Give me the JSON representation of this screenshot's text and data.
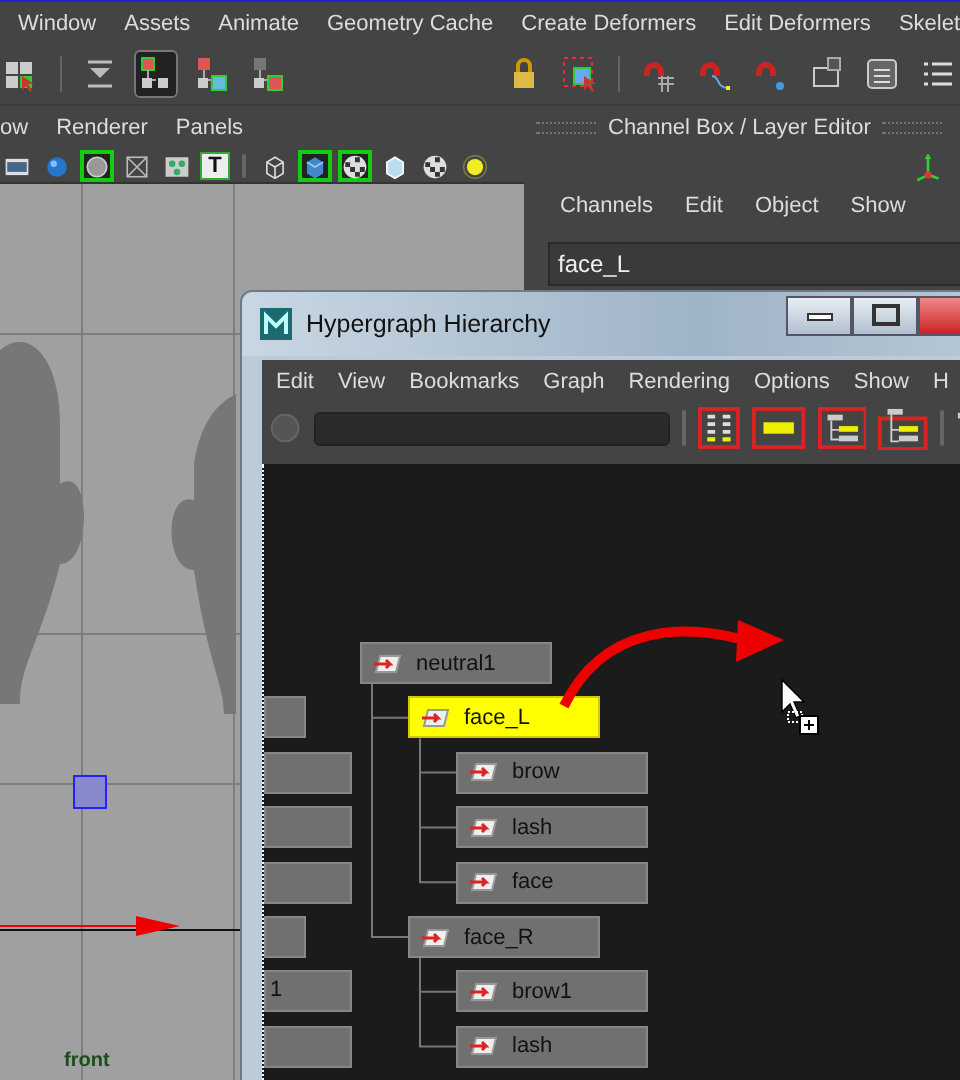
{
  "menubar": {
    "items": [
      "Window",
      "Assets",
      "Animate",
      "Geometry Cache",
      "Create Deformers",
      "Edit Deformers",
      "Skelet"
    ]
  },
  "toolbar": {
    "left_groups": [
      [
        {
          "kind": "grid",
          "selected": false
        }
      ],
      [
        {
          "kind": "align",
          "selected": false
        },
        {
          "kind": "hierarchy-red",
          "selected": true
        },
        {
          "kind": "hierarchy-blue",
          "selected": false
        },
        {
          "kind": "hierarchy-green",
          "selected": false
        }
      ]
    ],
    "right_groups": [
      [
        {
          "kind": "lock",
          "selected": false
        },
        {
          "kind": "select-box",
          "selected": false
        }
      ],
      [
        {
          "kind": "magnet-grid",
          "selected": false
        },
        {
          "kind": "magnet-curve",
          "selected": false
        },
        {
          "kind": "magnet-point",
          "selected": false
        },
        {
          "kind": "panel",
          "selected": false
        },
        {
          "kind": "calculator",
          "selected": false
        },
        {
          "kind": "list",
          "selected": false
        }
      ]
    ]
  },
  "viewport": {
    "menu": [
      "ow",
      "Renderer",
      "Panels"
    ],
    "icon_groups": [
      [
        {
          "kind": "film",
          "selected": false
        },
        {
          "kind": "sphere",
          "selected": false
        },
        {
          "kind": "circle",
          "selected": true
        },
        {
          "kind": "wire",
          "selected": false
        },
        {
          "kind": "points",
          "selected": false
        },
        {
          "kind": "text",
          "label": "T",
          "selected": false
        }
      ],
      [
        {
          "kind": "cube-wire",
          "selected": false
        },
        {
          "kind": "cube",
          "selected": true
        },
        {
          "kind": "checker",
          "selected": true
        },
        {
          "kind": "cube-light",
          "selected": false
        },
        {
          "kind": "checker",
          "selected": false
        },
        {
          "kind": "light",
          "selected": false
        }
      ]
    ],
    "camera_label": "front"
  },
  "channel_box": {
    "title": "Channel Box / Layer Editor",
    "menu": [
      "Channels",
      "Edit",
      "Object",
      "Show"
    ],
    "object_name": "face_L"
  },
  "hypergraph": {
    "title": "Hypergraph Hierarchy",
    "menu": [
      "Edit",
      "View",
      "Bookmarks",
      "Graph",
      "Rendering",
      "Options",
      "Show",
      "H"
    ],
    "nodes": [
      {
        "label": "neutral1",
        "selected": false,
        "children": [
          {
            "label": "face_L",
            "selected": true,
            "children": [
              {
                "label": "brow",
                "selected": false
              },
              {
                "label": "lash",
                "selected": false
              },
              {
                "label": "face",
                "selected": false
              }
            ]
          },
          {
            "label": "face_R",
            "selected": false,
            "children": [
              {
                "label": "brow1",
                "selected": false
              },
              {
                "label": "lash",
                "selected": false
              }
            ]
          }
        ]
      }
    ],
    "offscreen_nodes": [
      {
        "kind": "short"
      },
      {
        "kind": "long"
      },
      {
        "kind": "long"
      },
      {
        "kind": "long"
      },
      {
        "kind": "short"
      },
      {
        "kind": "long",
        "label": "1"
      },
      {
        "kind": "long"
      }
    ]
  }
}
